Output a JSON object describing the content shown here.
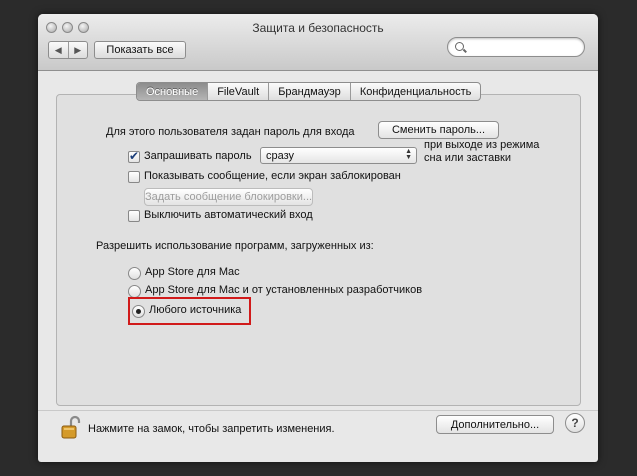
{
  "window": {
    "title": "Защита и безопасность"
  },
  "toolbar": {
    "back_icon": "◀",
    "forward_icon": "▶",
    "show_all_label": "Показать все",
    "search_placeholder": ""
  },
  "tabs": [
    {
      "label": "Основные",
      "active": true
    },
    {
      "label": "FileVault",
      "active": false
    },
    {
      "label": "Брандмауэр",
      "active": false
    },
    {
      "label": "Конфиденциальность",
      "active": false
    }
  ],
  "general": {
    "password_text": "Для этого пользователя задан пароль для входа",
    "change_password_label": "Сменить пароль...",
    "require_password_label": "Запрашивать пароль",
    "require_password_checked": true,
    "require_password_value": "сразу",
    "require_password_suffix_line1": "при выходе из режима",
    "require_password_suffix_line2": "сна или заставки",
    "show_message_label": "Показывать сообщение, если экран заблокирован",
    "show_message_checked": false,
    "set_lock_message_label": "Задать сообщение блокировки...",
    "disable_autologin_label": "Выключить автоматический вход",
    "disable_autologin_checked": false
  },
  "gatekeeper": {
    "heading": "Разрешить использование программ, загруженных из:",
    "options": [
      {
        "label": "App Store для Mac",
        "selected": false
      },
      {
        "label": "App Store для Mac и от установленных разработчиков",
        "selected": false
      },
      {
        "label": "Любого источника",
        "selected": true
      }
    ],
    "highlight_color": "#d11a1a"
  },
  "footer": {
    "lock_text": "Нажмите на замок, чтобы запретить изменения.",
    "advanced_label": "Дополнительно...",
    "help_label": "?"
  }
}
